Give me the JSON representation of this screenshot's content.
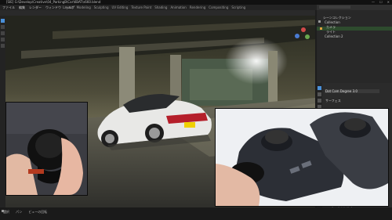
{
  "titlebar": {
    "title": "[SIE] G:\\Develop\\Creative\\04_ParkingB\\Car\\KBAT\\s660.blend",
    "win_controls": [
      "—",
      "☐",
      "✕"
    ]
  },
  "menubar": {
    "menus": [
      "ファイル",
      "編集",
      "レンダー",
      "ウィンドウ",
      "ヘルプ"
    ],
    "tabs": [
      "Layout",
      "Modeling",
      "Sculpting",
      "UV Editing",
      "Texture Paint",
      "Shading",
      "Animation",
      "Rendering",
      "Compositing",
      "Scripting"
    ],
    "active_tab": "Layout"
  },
  "outliner": {
    "items": [
      "シーンコレクション",
      "Collection",
      "カメラ",
      "ライト",
      "Collection 2"
    ]
  },
  "properties": {
    "header": "Dot Cam Degree 3.0",
    "section": "サーフェス",
    "bottom_items": [
      "オブジェクト",
      "レンダープロパティ"
    ]
  },
  "statusbar": {
    "left_items": [
      "選択",
      "パン",
      "ビューの回転"
    ]
  },
  "colors": {
    "accent": "#4a90d9",
    "bg_dark": "#1d1d1d",
    "panel": "#282828",
    "highlight_row": "#2e4b2e"
  }
}
